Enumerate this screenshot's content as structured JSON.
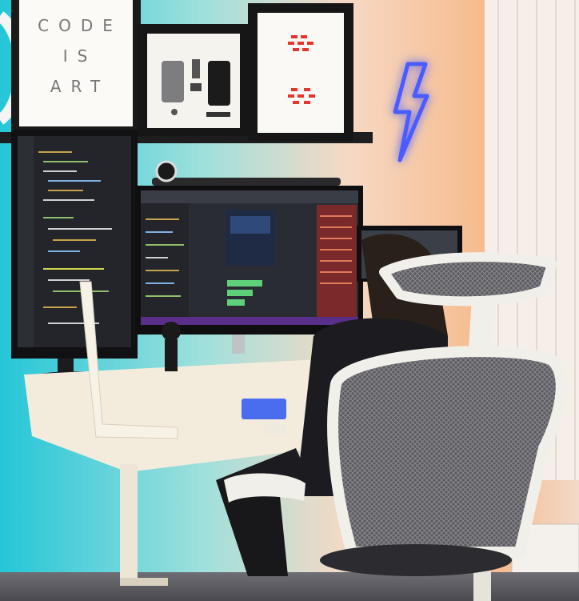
{
  "poster": {
    "line1": "CODE",
    "line2": "IS",
    "line3": "ART"
  },
  "colors": {
    "wall_left": "#2ec4d6",
    "wall_right": "#f2b98a",
    "neon": "#3b5cff",
    "desk": "#f3ecdd",
    "chair_frame": "#f1efe9",
    "chair_mesh": "#6b6b6b"
  },
  "icons": {
    "wall_light": "lightning-bolt-icon"
  }
}
